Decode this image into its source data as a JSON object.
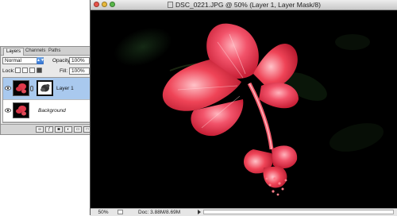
{
  "document": {
    "title": "DSC_0221.JPG @ 50% (Layer 1, Layer Mask/8)",
    "status": {
      "zoom": "50%",
      "doc_size": "Doc: 3.88M/8.69M"
    }
  },
  "layers_panel": {
    "tabs": [
      {
        "label": "Layers",
        "active": true
      },
      {
        "label": "Channels",
        "active": false
      },
      {
        "label": "Paths",
        "active": false
      }
    ],
    "blend_mode": "Normal",
    "opacity_label": "Opacity:",
    "opacity_value": "100%",
    "lock_label": "Lock:",
    "fill_label": "Fill:",
    "fill_value": "100%",
    "layers": [
      {
        "name": "Layer 1",
        "selected": true,
        "has_mask": true
      },
      {
        "name": "Background",
        "selected": false,
        "locked": true
      }
    ]
  },
  "colors": {
    "selection": "#a9c9ee",
    "canvas_background": "#000000",
    "flower_red": "#ef4457"
  }
}
